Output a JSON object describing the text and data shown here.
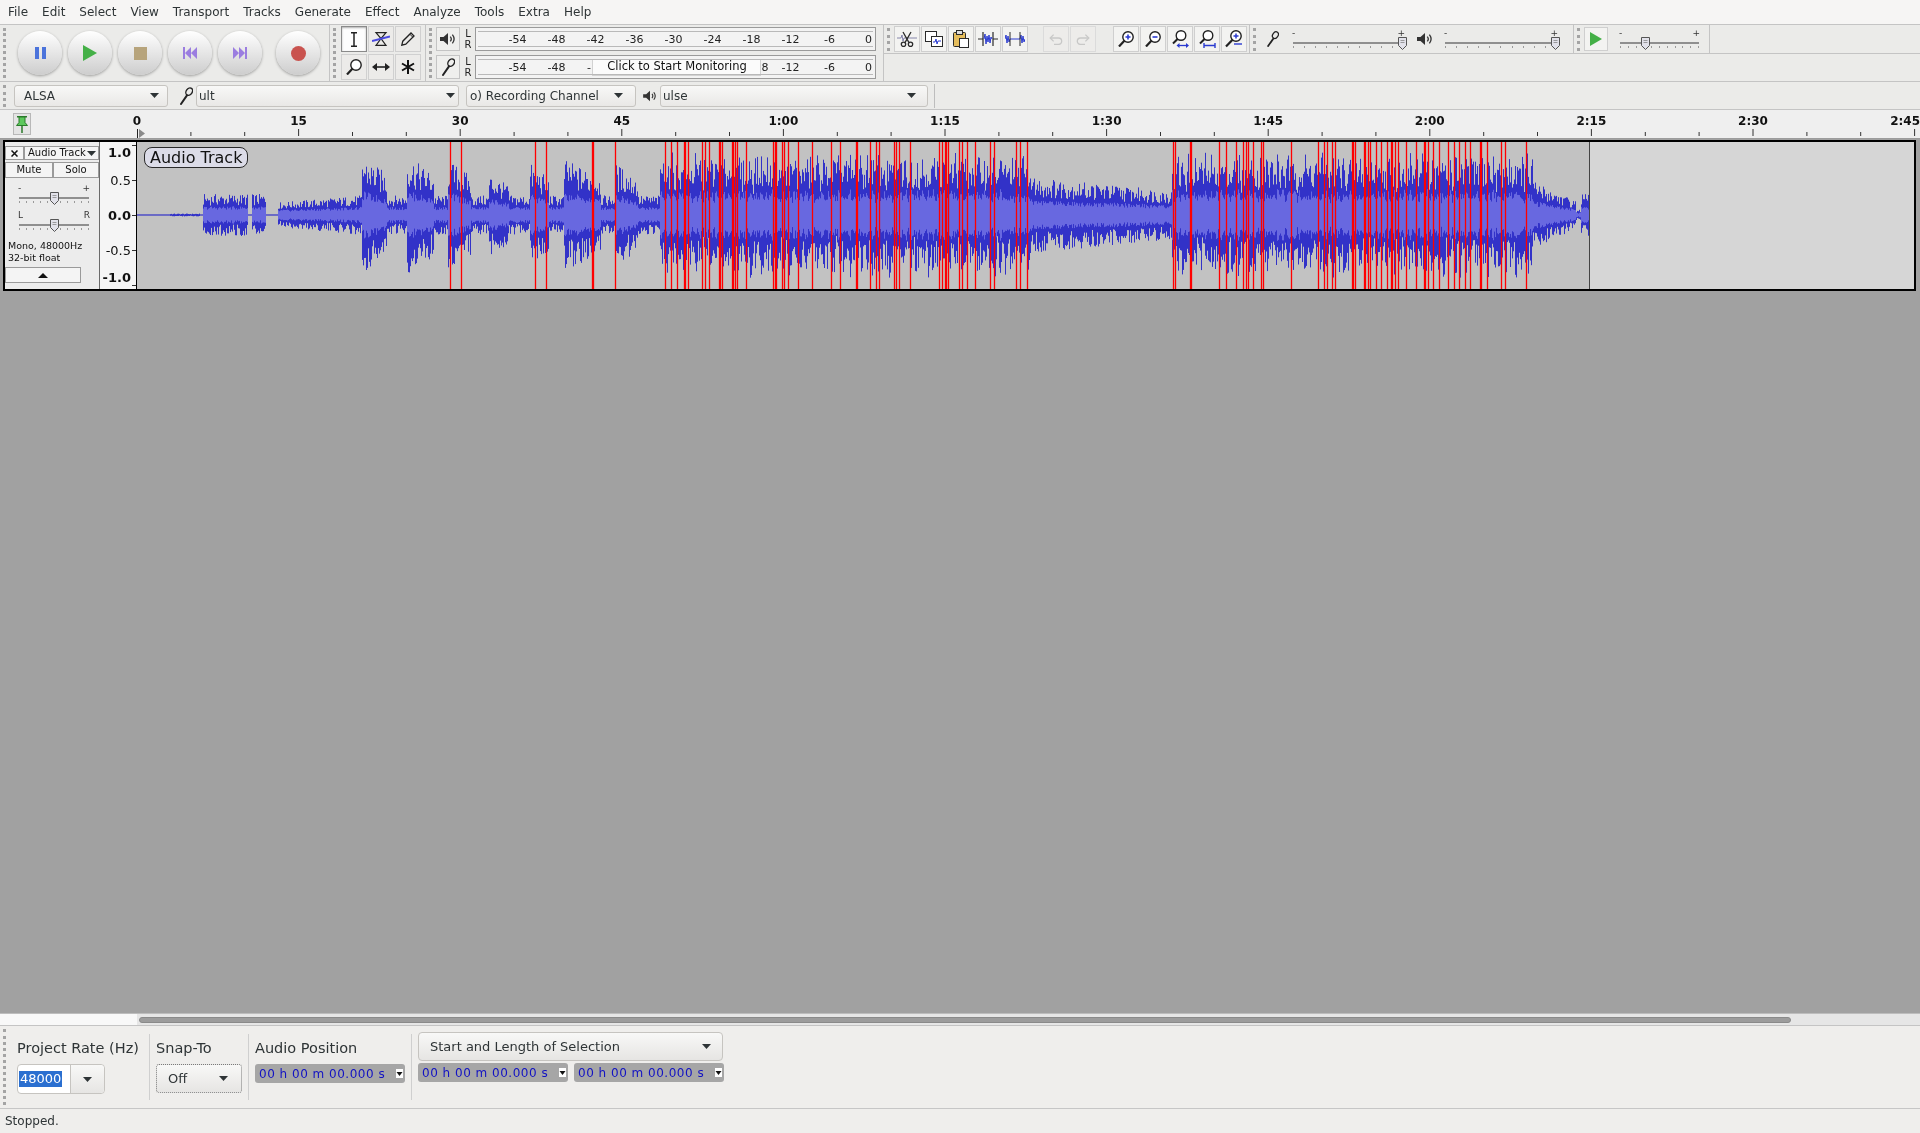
{
  "menu_bar": {
    "items": [
      "File",
      "Edit",
      "Select",
      "View",
      "Transport",
      "Tracks",
      "Generate",
      "Effect",
      "Analyze",
      "Tools",
      "Extra",
      "Help"
    ]
  },
  "tools_toolbar": {
    "tools": [
      {
        "kind": "select",
        "selected": true
      },
      {
        "kind": "envelope",
        "selected": false
      },
      {
        "kind": "draw",
        "selected": false
      },
      {
        "kind": "zoom",
        "selected": false
      },
      {
        "kind": "timeshift",
        "selected": false
      },
      {
        "kind": "multi",
        "selected": false
      }
    ]
  },
  "meter_toolbar": {
    "playback": {
      "channels": [
        "L",
        "R"
      ],
      "scale": [
        "-54",
        "-48",
        "-42",
        "-36",
        "-30",
        "-24",
        "-18",
        "-12",
        "-6",
        "0"
      ]
    },
    "recording": {
      "channels": [
        "L",
        "R"
      ],
      "scale_start": [
        "-54",
        "-48"
      ],
      "partial_before": "-",
      "monitor_prompt": "Click to Start Monitoring",
      "partial_after": "8",
      "scale_end": [
        "-12",
        "-6",
        "0"
      ]
    }
  },
  "edit_toolbar": {
    "buttons": [
      {
        "kind": "cut",
        "disabled": false
      },
      {
        "kind": "copy",
        "disabled": false
      },
      {
        "kind": "paste",
        "disabled": false
      },
      {
        "kind": "trim",
        "disabled": false
      },
      {
        "kind": "silence",
        "disabled": false
      },
      {
        "kind": "undo",
        "disabled": true
      },
      {
        "kind": "redo",
        "disabled": true
      }
    ]
  },
  "mixer_toolbar": {
    "recording_volume": {
      "min_label": "-",
      "max_label": "+",
      "level": 1
    },
    "playback_volume": {
      "min_label": "-",
      "max_label": "+",
      "level": 1
    }
  },
  "play_at_speed": {
    "min_label": "-",
    "max_label": "+",
    "level": 0.32
  },
  "device_toolbar": {
    "host": "ALSA",
    "recording_device": "ult",
    "recording_channels": "o) Recording Channel",
    "playback_device": "ulse"
  },
  "timeline_ruler": {
    "labels": [
      "0",
      "15",
      "30",
      "45",
      "1:00",
      "1:15",
      "1:30",
      "1:45",
      "2:00",
      "2:15",
      "2:30",
      "2:45"
    ]
  },
  "track": {
    "name": "Audio Track",
    "mute": {
      "label": "Mute",
      "on": false
    },
    "solo": {
      "label": "Solo",
      "on": false
    },
    "gain": {
      "min_label": "-",
      "max_label": "+",
      "level": 0.5
    },
    "pan": {
      "min_label": "L",
      "max_label": "R",
      "level": 0.5
    },
    "info": [
      "Mono, 48000Hz",
      "32-bit float"
    ],
    "amplitude_labels": [
      {
        "text": "1.0",
        "major": true
      },
      {
        "text": "0.5",
        "major": false
      },
      {
        "text": "0.0",
        "major": true
      },
      {
        "text": "-0.5",
        "major": false
      },
      {
        "text": "-1.0",
        "major": true
      }
    ],
    "clip_name": "Audio Track"
  },
  "selection_toolbar": {
    "project_rate": {
      "label": "Project Rate (Hz)",
      "value": "48000",
      "highlighted": true
    },
    "snap_to": {
      "label": "Snap-To",
      "value": "Off"
    },
    "audio_position": {
      "label": "Audio Position",
      "value": "00 h 00 m 00.000 s"
    },
    "selection": {
      "mode": "Start and Length of Selection",
      "start": "00 h 00 m 00.000 s",
      "length": "00 h 00 m 00.000 s"
    }
  },
  "status_bar": {
    "text": "Stopped."
  }
}
